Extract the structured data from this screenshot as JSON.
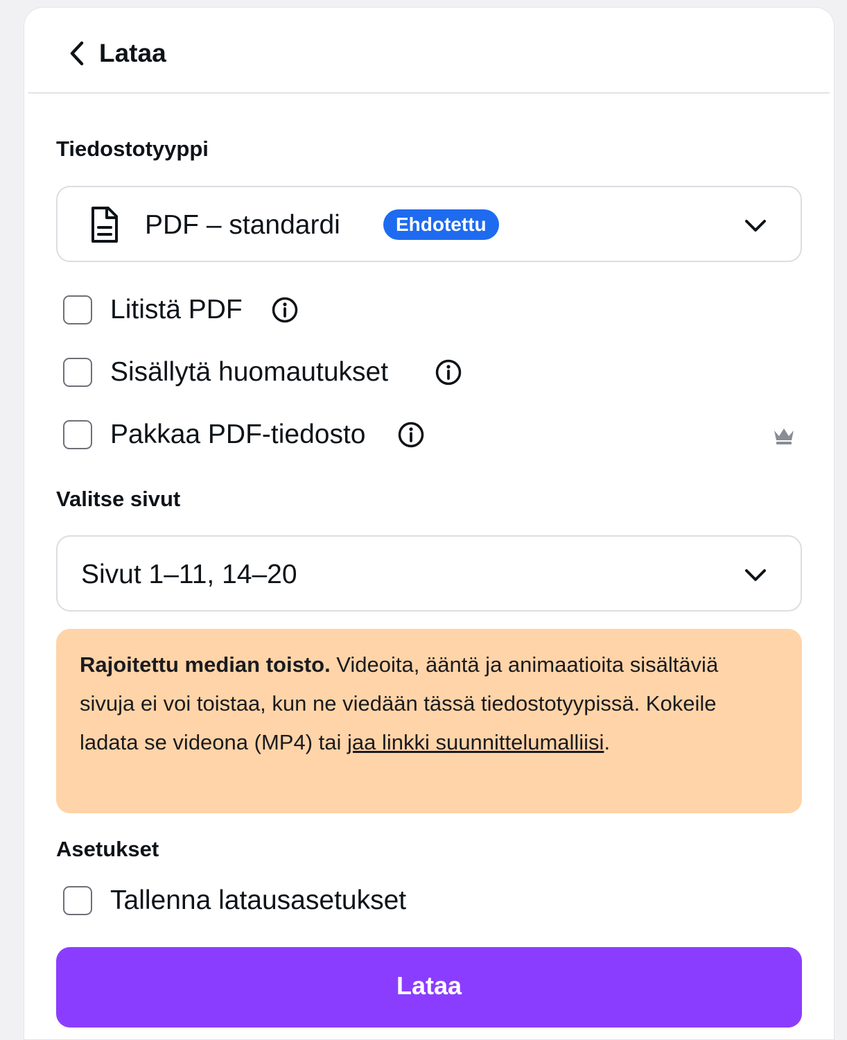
{
  "header": {
    "back_icon": "chevron-left-icon",
    "title": "Lataa"
  },
  "file_type": {
    "label": "Tiedostotyyppi",
    "icon": "document-icon",
    "selected": "PDF – standardi",
    "badge": "Ehdotettu",
    "badge_color": "#1e6bf0"
  },
  "options": [
    {
      "label": "Litistä PDF",
      "checked": false,
      "info_icon": "info-icon"
    },
    {
      "label": "Sisällytä huomautukset",
      "checked": false,
      "info_icon": "info-icon"
    },
    {
      "label": "Pakkaa PDF-tiedosto",
      "checked": false,
      "info_icon": "info-icon",
      "premium_icon": "crown-icon"
    }
  ],
  "pages": {
    "label": "Valitse sivut",
    "selected": "Sivut 1–11, 14–20"
  },
  "notice": {
    "title": "Rajoitettu median toisto.",
    "body": " Videoita, ääntä ja animaatioita sisältäviä sivuja ei voi toistaa, kun ne viedään tässä tiedostotyypissä. Kokeile ladata se videona (MP4) tai ",
    "link": "jaa linkki suunnittelumalliisi",
    "end": ".",
    "background": "#ffd4a8"
  },
  "settings": {
    "label": "Asetukset",
    "save_option": "Tallenna latausasetukset",
    "save_checked": false
  },
  "download_button": {
    "label": "Lataa",
    "color": "#8b3dff"
  }
}
